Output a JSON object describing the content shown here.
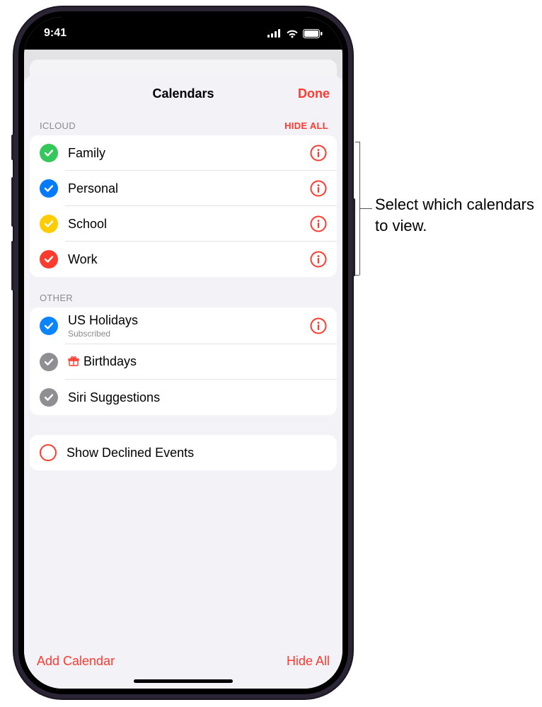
{
  "status": {
    "time": "9:41"
  },
  "modal": {
    "title": "Calendars",
    "done": "Done",
    "sections": [
      {
        "label": "ICLOUD",
        "action": "HIDE ALL",
        "items": [
          {
            "title": "Family",
            "color": "#34c759",
            "checked": true,
            "info": true
          },
          {
            "title": "Personal",
            "color": "#007aff",
            "checked": true,
            "info": true
          },
          {
            "title": "School",
            "color": "#ffcc00",
            "checked": true,
            "info": true
          },
          {
            "title": "Work",
            "color": "#ff3b30",
            "checked": true,
            "info": true
          }
        ]
      },
      {
        "label": "OTHER",
        "action": "",
        "items": [
          {
            "title": "US Holidays",
            "subtitle": "Subscribed",
            "color": "#0a84ff",
            "checked": true,
            "info": true
          },
          {
            "title": "Birthdays",
            "icon": "gift-icon",
            "color": "#8e8e93",
            "checked": true,
            "info": false
          },
          {
            "title": "Siri Suggestions",
            "color": "#8e8e93",
            "checked": true,
            "info": false
          }
        ]
      }
    ],
    "declined": {
      "title": "Show Declined Events",
      "checked": false
    },
    "toolbar": {
      "add": "Add Calendar",
      "hide": "Hide All"
    }
  },
  "callout": {
    "text": "Select which calendars to view."
  }
}
